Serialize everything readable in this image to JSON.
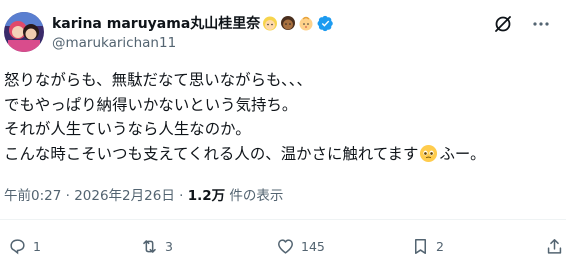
{
  "author": {
    "display_name": "karina maruyama丸山桂里奈",
    "handle": "@marukarichan11",
    "emojis": [
      "blonde-person-emoji",
      "dark-person-emoji",
      "baby-emoji"
    ],
    "verified": true
  },
  "toolbar": {
    "grok_icon": "grok-icon",
    "more_icon": "more-icon"
  },
  "tweet": {
    "lines": [
      "怒りながらも、無駄だなて思いながらも、、、",
      "でもやっぱり納得いかないという気持ち。",
      "それが人生ていうなら人生なのか。",
      "こんな時こそいつも支えてくれる人の、温かさに触れてます"
    ],
    "line4_suffix": "ふー。",
    "inline_emoji": "pleading-face-emoji"
  },
  "meta": {
    "time": "午前0:27 · 2026年2月26日 · ",
    "views": "1.2万",
    "views_label": " 件の表示"
  },
  "actions": {
    "reply_count": "1",
    "retweet_count": "3",
    "like_count": "145",
    "bookmark_count": "2"
  },
  "colors": {
    "text": "#0f1419",
    "secondary": "#536471",
    "verified": "#1d9bf0",
    "divider": "#eff3f4"
  }
}
